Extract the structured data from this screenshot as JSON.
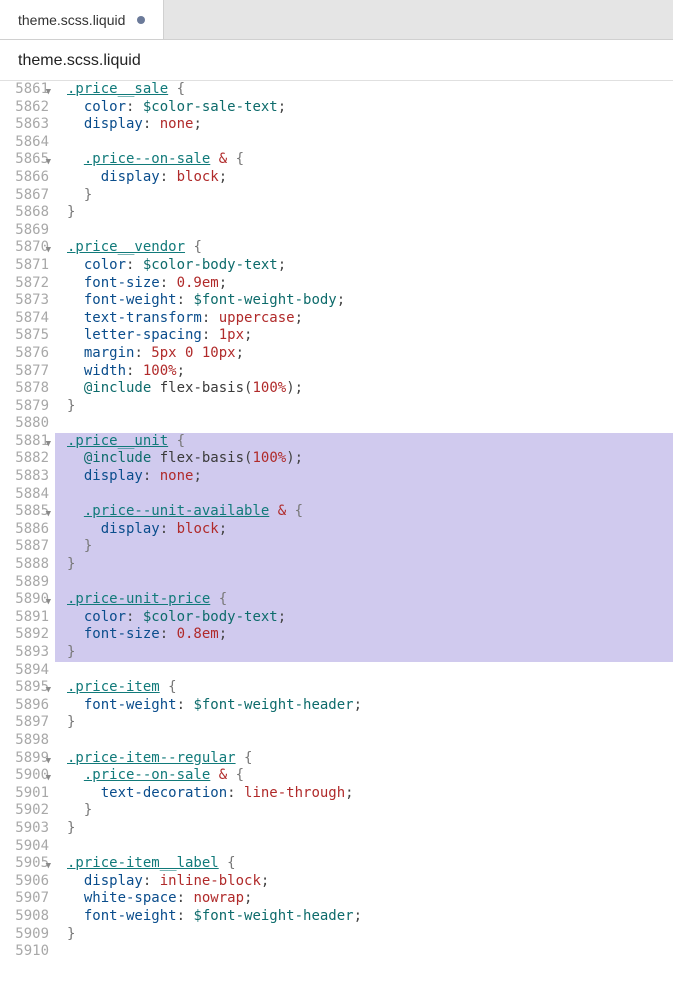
{
  "tab": {
    "label": "theme.scss.liquid",
    "modified": true
  },
  "breadcrumb": "theme.scss.liquid",
  "startLine": 5861,
  "highlight": {
    "from": 5881,
    "to": 5893
  },
  "foldLines": [
    5861,
    5865,
    5870,
    5881,
    5885,
    5890,
    5895,
    5899,
    5900,
    5905
  ],
  "lines": [
    [
      [
        "sel",
        ".price__sale"
      ],
      [
        "t",
        " "
      ],
      [
        "brace",
        "{"
      ]
    ],
    [
      [
        "t",
        "  "
      ],
      [
        "prop",
        "color"
      ],
      [
        "punc",
        ": "
      ],
      [
        "var",
        "$color-sale-text"
      ],
      [
        "punc",
        ";"
      ]
    ],
    [
      [
        "t",
        "  "
      ],
      [
        "prop",
        "display"
      ],
      [
        "punc",
        ": "
      ],
      [
        "val",
        "none"
      ],
      [
        "punc",
        ";"
      ]
    ],
    [],
    [
      [
        "t",
        "  "
      ],
      [
        "sel",
        ".price--on-sale"
      ],
      [
        "t",
        " "
      ],
      [
        "amp",
        "&"
      ],
      [
        "t",
        " "
      ],
      [
        "brace",
        "{"
      ]
    ],
    [
      [
        "t",
        "    "
      ],
      [
        "prop",
        "display"
      ],
      [
        "punc",
        ": "
      ],
      [
        "val",
        "block"
      ],
      [
        "punc",
        ";"
      ]
    ],
    [
      [
        "t",
        "  "
      ],
      [
        "brace",
        "}"
      ]
    ],
    [
      [
        "brace",
        "}"
      ]
    ],
    [],
    [
      [
        "sel",
        ".price__vendor"
      ],
      [
        "t",
        " "
      ],
      [
        "brace",
        "{"
      ]
    ],
    [
      [
        "t",
        "  "
      ],
      [
        "prop",
        "color"
      ],
      [
        "punc",
        ": "
      ],
      [
        "var",
        "$color-body-text"
      ],
      [
        "punc",
        ";"
      ]
    ],
    [
      [
        "t",
        "  "
      ],
      [
        "prop",
        "font-size"
      ],
      [
        "punc",
        ": "
      ],
      [
        "num",
        "0.9em"
      ],
      [
        "punc",
        ";"
      ]
    ],
    [
      [
        "t",
        "  "
      ],
      [
        "prop",
        "font-weight"
      ],
      [
        "punc",
        ": "
      ],
      [
        "var",
        "$font-weight-body"
      ],
      [
        "punc",
        ";"
      ]
    ],
    [
      [
        "t",
        "  "
      ],
      [
        "prop",
        "text-transform"
      ],
      [
        "punc",
        ": "
      ],
      [
        "val",
        "uppercase"
      ],
      [
        "punc",
        ";"
      ]
    ],
    [
      [
        "t",
        "  "
      ],
      [
        "prop",
        "letter-spacing"
      ],
      [
        "punc",
        ": "
      ],
      [
        "num",
        "1px"
      ],
      [
        "punc",
        ";"
      ]
    ],
    [
      [
        "t",
        "  "
      ],
      [
        "prop",
        "margin"
      ],
      [
        "punc",
        ": "
      ],
      [
        "num",
        "5px 0 10px"
      ],
      [
        "punc",
        ";"
      ]
    ],
    [
      [
        "t",
        "  "
      ],
      [
        "prop",
        "width"
      ],
      [
        "punc",
        ": "
      ],
      [
        "num",
        "100%"
      ],
      [
        "punc",
        ";"
      ]
    ],
    [
      [
        "t",
        "  "
      ],
      [
        "atrule",
        "@include"
      ],
      [
        "t",
        " "
      ],
      [
        "fn",
        "flex-basis"
      ],
      [
        "punc",
        "("
      ],
      [
        "num",
        "100%"
      ],
      [
        "punc",
        ");"
      ]
    ],
    [
      [
        "brace",
        "}"
      ]
    ],
    [],
    [
      [
        "sel",
        ".price__unit"
      ],
      [
        "t",
        " "
      ],
      [
        "brace",
        "{"
      ]
    ],
    [
      [
        "t",
        "  "
      ],
      [
        "atrule",
        "@include"
      ],
      [
        "t",
        " "
      ],
      [
        "fn",
        "flex-basis"
      ],
      [
        "punc",
        "("
      ],
      [
        "num",
        "100%"
      ],
      [
        "punc",
        ");"
      ]
    ],
    [
      [
        "t",
        "  "
      ],
      [
        "prop",
        "display"
      ],
      [
        "punc",
        ": "
      ],
      [
        "val",
        "none"
      ],
      [
        "punc",
        ";"
      ]
    ],
    [],
    [
      [
        "t",
        "  "
      ],
      [
        "sel",
        ".price--unit-available"
      ],
      [
        "t",
        " "
      ],
      [
        "amp",
        "&"
      ],
      [
        "t",
        " "
      ],
      [
        "brace",
        "{"
      ]
    ],
    [
      [
        "t",
        "    "
      ],
      [
        "prop",
        "display"
      ],
      [
        "punc",
        ": "
      ],
      [
        "val",
        "block"
      ],
      [
        "punc",
        ";"
      ]
    ],
    [
      [
        "t",
        "  "
      ],
      [
        "brace",
        "}"
      ]
    ],
    [
      [
        "brace",
        "}"
      ]
    ],
    [],
    [
      [
        "sel",
        ".price-unit-price"
      ],
      [
        "t",
        " "
      ],
      [
        "brace",
        "{"
      ]
    ],
    [
      [
        "t",
        "  "
      ],
      [
        "prop",
        "color"
      ],
      [
        "punc",
        ": "
      ],
      [
        "var",
        "$color-body-text"
      ],
      [
        "punc",
        ";"
      ]
    ],
    [
      [
        "t",
        "  "
      ],
      [
        "prop",
        "font-size"
      ],
      [
        "punc",
        ": "
      ],
      [
        "num",
        "0.8em"
      ],
      [
        "punc",
        ";"
      ]
    ],
    [
      [
        "brace",
        "}"
      ]
    ],
    [],
    [
      [
        "sel",
        ".price-item"
      ],
      [
        "t",
        " "
      ],
      [
        "brace",
        "{"
      ]
    ],
    [
      [
        "t",
        "  "
      ],
      [
        "prop",
        "font-weight"
      ],
      [
        "punc",
        ": "
      ],
      [
        "var",
        "$font-weight-header"
      ],
      [
        "punc",
        ";"
      ]
    ],
    [
      [
        "brace",
        "}"
      ]
    ],
    [],
    [
      [
        "sel",
        ".price-item--regular"
      ],
      [
        "t",
        " "
      ],
      [
        "brace",
        "{"
      ]
    ],
    [
      [
        "t",
        "  "
      ],
      [
        "sel",
        ".price--on-sale"
      ],
      [
        "t",
        " "
      ],
      [
        "amp",
        "&"
      ],
      [
        "t",
        " "
      ],
      [
        "brace",
        "{"
      ]
    ],
    [
      [
        "t",
        "    "
      ],
      [
        "prop",
        "text-decoration"
      ],
      [
        "punc",
        ": "
      ],
      [
        "val",
        "line-through"
      ],
      [
        "punc",
        ";"
      ]
    ],
    [
      [
        "t",
        "  "
      ],
      [
        "brace",
        "}"
      ]
    ],
    [
      [
        "brace",
        "}"
      ]
    ],
    [],
    [
      [
        "sel",
        ".price-item__label"
      ],
      [
        "t",
        " "
      ],
      [
        "brace",
        "{"
      ]
    ],
    [
      [
        "t",
        "  "
      ],
      [
        "prop",
        "display"
      ],
      [
        "punc",
        ": "
      ],
      [
        "val",
        "inline-block"
      ],
      [
        "punc",
        ";"
      ]
    ],
    [
      [
        "t",
        "  "
      ],
      [
        "prop",
        "white-space"
      ],
      [
        "punc",
        ": "
      ],
      [
        "val",
        "nowrap"
      ],
      [
        "punc",
        ";"
      ]
    ],
    [
      [
        "t",
        "  "
      ],
      [
        "prop",
        "font-weight"
      ],
      [
        "punc",
        ": "
      ],
      [
        "var",
        "$font-weight-header"
      ],
      [
        "punc",
        ";"
      ]
    ],
    [
      [
        "brace",
        "}"
      ]
    ],
    []
  ]
}
